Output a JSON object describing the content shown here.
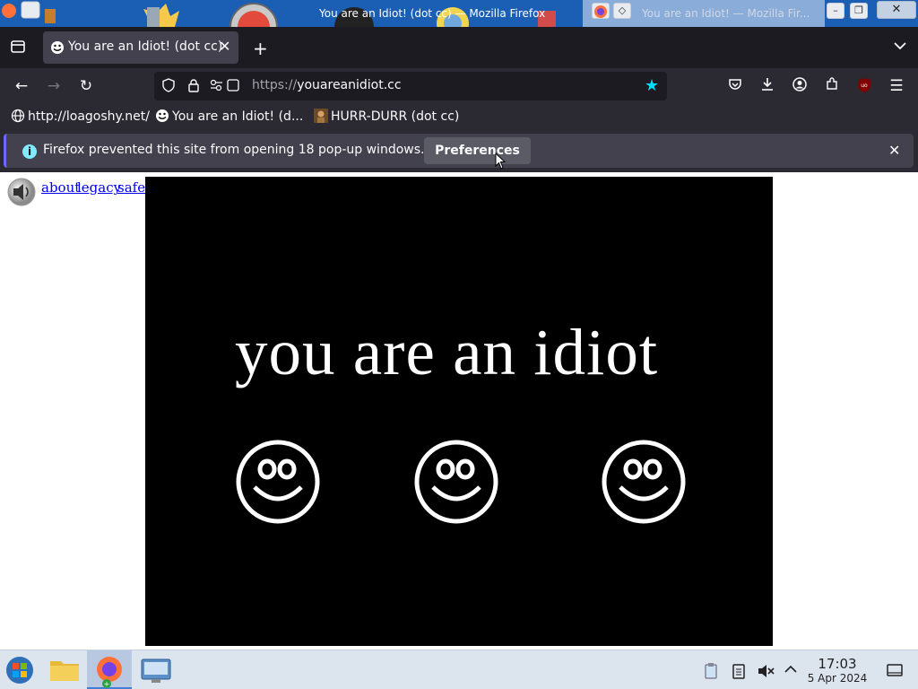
{
  "window": {
    "title": "You are an Idiot! (dot cc) — Mozilla Firefox",
    "background_title": "You are an Idiot! — Mozilla Fir..."
  },
  "tab": {
    "label": "You are an Idiot! (dot cc)"
  },
  "urlbar": {
    "scheme": "https://",
    "host": "youareanidiot.cc"
  },
  "bookmarks": [
    {
      "label": "http://loagoshy.net/"
    },
    {
      "label": "You are an Idiot! (d..."
    },
    {
      "label": "HURR-DURR (dot cc)"
    }
  ],
  "notification": {
    "message": "Firefox prevented this site from opening 18 pop-up windows.",
    "button_label": "Preferences"
  },
  "page": {
    "links": [
      "about",
      "legacy",
      "safe"
    ],
    "headline": "you are an idiot"
  },
  "taskbar": {
    "time": "17:03",
    "date": "5 Apr 2024"
  },
  "colors": {
    "firefox_chrome": "#2b2a33",
    "tab_strip": "#1c1b22",
    "accent_star": "#00ddff",
    "link": "#0000ee"
  }
}
